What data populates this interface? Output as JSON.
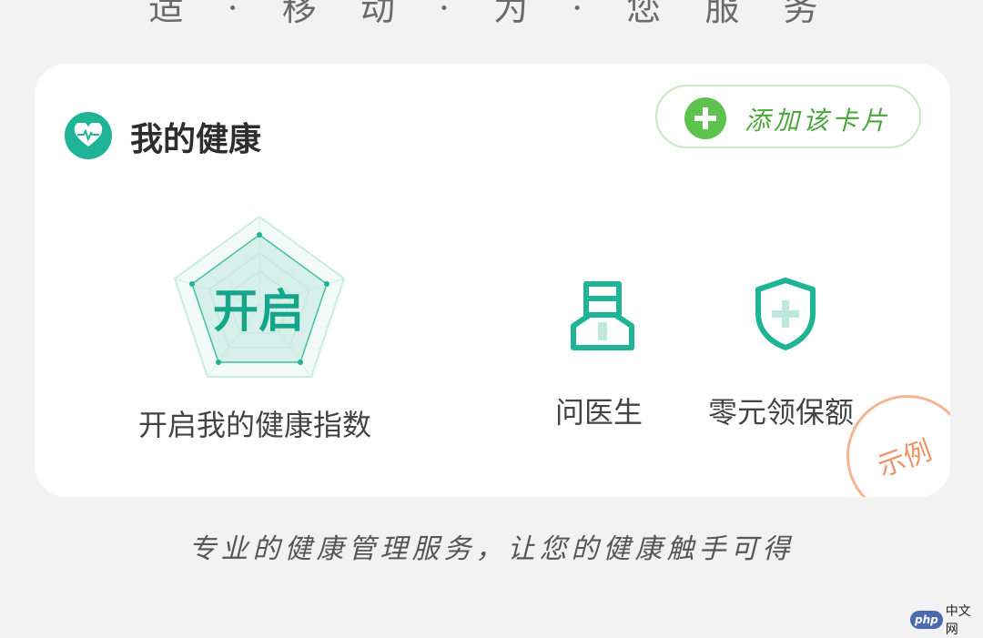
{
  "page": {
    "top_partial_text": "适 · 移 动 · 为 · 您 服 务"
  },
  "card": {
    "title": "我的健康",
    "add_button_label": "添加该卡片",
    "radar_label": "开启",
    "index_label": "开启我的健康指数",
    "items": [
      {
        "label": "问医生",
        "icon": "doctor-icon"
      },
      {
        "label": "零元领保额",
        "icon": "shield-plus-icon"
      }
    ],
    "stamp_text": "示例"
  },
  "tagline": "专业的健康管理服务，让您的健康触手可得",
  "watermark": {
    "badge": "php",
    "site": "中文网"
  },
  "colors": {
    "brand_teal": "#1fb495",
    "add_green": "#5dc24e",
    "stamp_orange": "#ee9664"
  }
}
